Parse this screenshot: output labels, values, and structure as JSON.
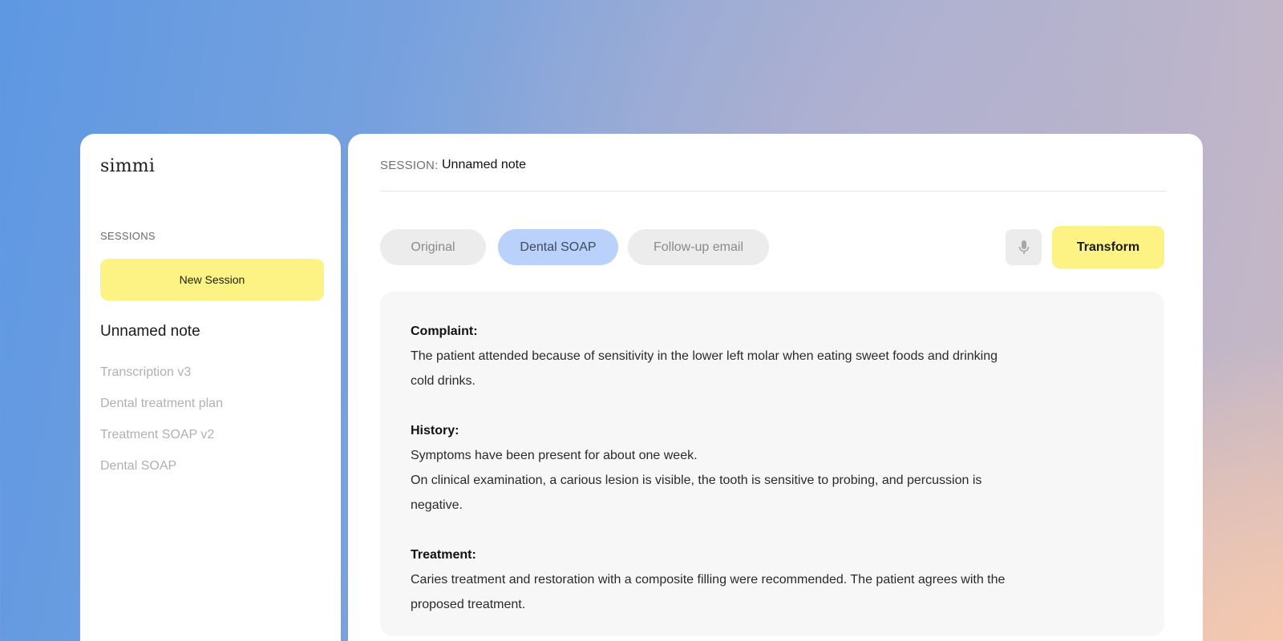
{
  "app": {
    "logo": "simmi"
  },
  "sidebar": {
    "sessions_label": "SESSIONS",
    "new_session_label": "New Session",
    "current_session": "Unnamed note",
    "items": [
      {
        "label": "Transcription v3"
      },
      {
        "label": "Dental treatment plan"
      },
      {
        "label": "Treatment SOAP v2"
      },
      {
        "label": "Dental SOAP"
      }
    ]
  },
  "header": {
    "session_prefix": "SESSION:",
    "session_name": "Unnamed note"
  },
  "tabs": [
    {
      "label": "Original",
      "active": false
    },
    {
      "label": "Dental SOAP",
      "active": true
    },
    {
      "label": "Follow-up email",
      "active": false
    }
  ],
  "toolbar": {
    "mic_icon": "microphone-icon",
    "transform_label": "Transform"
  },
  "note": {
    "sections": [
      {
        "title": "Complaint:",
        "lines": [
          "The patient attended because of sensitivity in the lower left molar when eating sweet foods and drinking cold drinks."
        ]
      },
      {
        "title": "History:",
        "lines": [
          "Symptoms have been present for about one week.",
          "On clinical examination, a carious lesion is visible, the tooth is sensitive to probing, and percussion is negative."
        ]
      },
      {
        "title": "Treatment:",
        "lines": [
          "Caries treatment and restoration with a composite filling were recommended. The patient agrees with the proposed treatment."
        ]
      }
    ]
  },
  "colors": {
    "accent_yellow": "#fdf384",
    "active_tab_blue": "#b9d1fb",
    "tab_grey": "#ececec",
    "content_bg": "#f7f7f7"
  }
}
